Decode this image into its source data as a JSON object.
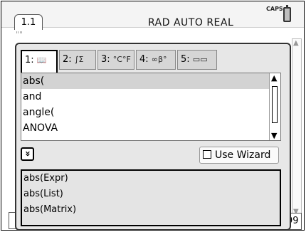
{
  "topbar": {
    "tab_label": "1.1",
    "modes": "RAD AUTO REAL",
    "caps": "CAPS"
  },
  "background": {
    "hint": "\"\"",
    "page_number": "99"
  },
  "catalog": {
    "tabs": [
      {
        "label": "1:",
        "glyph": "📖",
        "active": true
      },
      {
        "label": "2:",
        "glyph": "∫Σ"
      },
      {
        "label": "3:",
        "glyph": "°C°F"
      },
      {
        "label": "4:",
        "glyph": "∞β°"
      },
      {
        "label": "5:",
        "glyph": "▭▭"
      }
    ],
    "items": [
      "abs(",
      "and",
      "angle(",
      "ANOVA"
    ],
    "selected_index": 0,
    "wizard_label": "Use Wizard",
    "help_lines": [
      "abs(Expr)",
      "abs(List)",
      "abs(Matrix)"
    ]
  }
}
